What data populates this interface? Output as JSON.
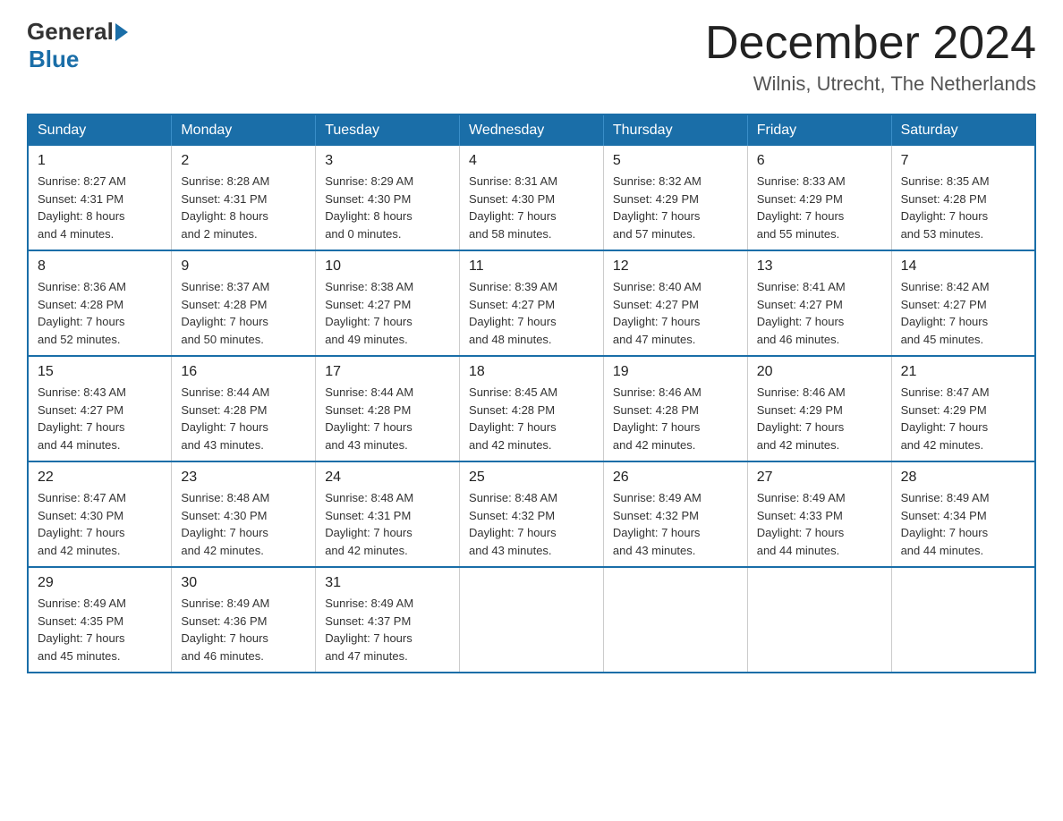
{
  "header": {
    "logo": {
      "general": "General",
      "blue": "Blue"
    },
    "title": "December 2024",
    "location": "Wilnis, Utrecht, The Netherlands"
  },
  "days_of_week": [
    "Sunday",
    "Monday",
    "Tuesday",
    "Wednesday",
    "Thursday",
    "Friday",
    "Saturday"
  ],
  "weeks": [
    [
      {
        "day": "1",
        "info": "Sunrise: 8:27 AM\nSunset: 4:31 PM\nDaylight: 8 hours\nand 4 minutes."
      },
      {
        "day": "2",
        "info": "Sunrise: 8:28 AM\nSunset: 4:31 PM\nDaylight: 8 hours\nand 2 minutes."
      },
      {
        "day": "3",
        "info": "Sunrise: 8:29 AM\nSunset: 4:30 PM\nDaylight: 8 hours\nand 0 minutes."
      },
      {
        "day": "4",
        "info": "Sunrise: 8:31 AM\nSunset: 4:30 PM\nDaylight: 7 hours\nand 58 minutes."
      },
      {
        "day": "5",
        "info": "Sunrise: 8:32 AM\nSunset: 4:29 PM\nDaylight: 7 hours\nand 57 minutes."
      },
      {
        "day": "6",
        "info": "Sunrise: 8:33 AM\nSunset: 4:29 PM\nDaylight: 7 hours\nand 55 minutes."
      },
      {
        "day": "7",
        "info": "Sunrise: 8:35 AM\nSunset: 4:28 PM\nDaylight: 7 hours\nand 53 minutes."
      }
    ],
    [
      {
        "day": "8",
        "info": "Sunrise: 8:36 AM\nSunset: 4:28 PM\nDaylight: 7 hours\nand 52 minutes."
      },
      {
        "day": "9",
        "info": "Sunrise: 8:37 AM\nSunset: 4:28 PM\nDaylight: 7 hours\nand 50 minutes."
      },
      {
        "day": "10",
        "info": "Sunrise: 8:38 AM\nSunset: 4:27 PM\nDaylight: 7 hours\nand 49 minutes."
      },
      {
        "day": "11",
        "info": "Sunrise: 8:39 AM\nSunset: 4:27 PM\nDaylight: 7 hours\nand 48 minutes."
      },
      {
        "day": "12",
        "info": "Sunrise: 8:40 AM\nSunset: 4:27 PM\nDaylight: 7 hours\nand 47 minutes."
      },
      {
        "day": "13",
        "info": "Sunrise: 8:41 AM\nSunset: 4:27 PM\nDaylight: 7 hours\nand 46 minutes."
      },
      {
        "day": "14",
        "info": "Sunrise: 8:42 AM\nSunset: 4:27 PM\nDaylight: 7 hours\nand 45 minutes."
      }
    ],
    [
      {
        "day": "15",
        "info": "Sunrise: 8:43 AM\nSunset: 4:27 PM\nDaylight: 7 hours\nand 44 minutes."
      },
      {
        "day": "16",
        "info": "Sunrise: 8:44 AM\nSunset: 4:28 PM\nDaylight: 7 hours\nand 43 minutes."
      },
      {
        "day": "17",
        "info": "Sunrise: 8:44 AM\nSunset: 4:28 PM\nDaylight: 7 hours\nand 43 minutes."
      },
      {
        "day": "18",
        "info": "Sunrise: 8:45 AM\nSunset: 4:28 PM\nDaylight: 7 hours\nand 42 minutes."
      },
      {
        "day": "19",
        "info": "Sunrise: 8:46 AM\nSunset: 4:28 PM\nDaylight: 7 hours\nand 42 minutes."
      },
      {
        "day": "20",
        "info": "Sunrise: 8:46 AM\nSunset: 4:29 PM\nDaylight: 7 hours\nand 42 minutes."
      },
      {
        "day": "21",
        "info": "Sunrise: 8:47 AM\nSunset: 4:29 PM\nDaylight: 7 hours\nand 42 minutes."
      }
    ],
    [
      {
        "day": "22",
        "info": "Sunrise: 8:47 AM\nSunset: 4:30 PM\nDaylight: 7 hours\nand 42 minutes."
      },
      {
        "day": "23",
        "info": "Sunrise: 8:48 AM\nSunset: 4:30 PM\nDaylight: 7 hours\nand 42 minutes."
      },
      {
        "day": "24",
        "info": "Sunrise: 8:48 AM\nSunset: 4:31 PM\nDaylight: 7 hours\nand 42 minutes."
      },
      {
        "day": "25",
        "info": "Sunrise: 8:48 AM\nSunset: 4:32 PM\nDaylight: 7 hours\nand 43 minutes."
      },
      {
        "day": "26",
        "info": "Sunrise: 8:49 AM\nSunset: 4:32 PM\nDaylight: 7 hours\nand 43 minutes."
      },
      {
        "day": "27",
        "info": "Sunrise: 8:49 AM\nSunset: 4:33 PM\nDaylight: 7 hours\nand 44 minutes."
      },
      {
        "day": "28",
        "info": "Sunrise: 8:49 AM\nSunset: 4:34 PM\nDaylight: 7 hours\nand 44 minutes."
      }
    ],
    [
      {
        "day": "29",
        "info": "Sunrise: 8:49 AM\nSunset: 4:35 PM\nDaylight: 7 hours\nand 45 minutes."
      },
      {
        "day": "30",
        "info": "Sunrise: 8:49 AM\nSunset: 4:36 PM\nDaylight: 7 hours\nand 46 minutes."
      },
      {
        "day": "31",
        "info": "Sunrise: 8:49 AM\nSunset: 4:37 PM\nDaylight: 7 hours\nand 47 minutes."
      },
      null,
      null,
      null,
      null
    ]
  ]
}
